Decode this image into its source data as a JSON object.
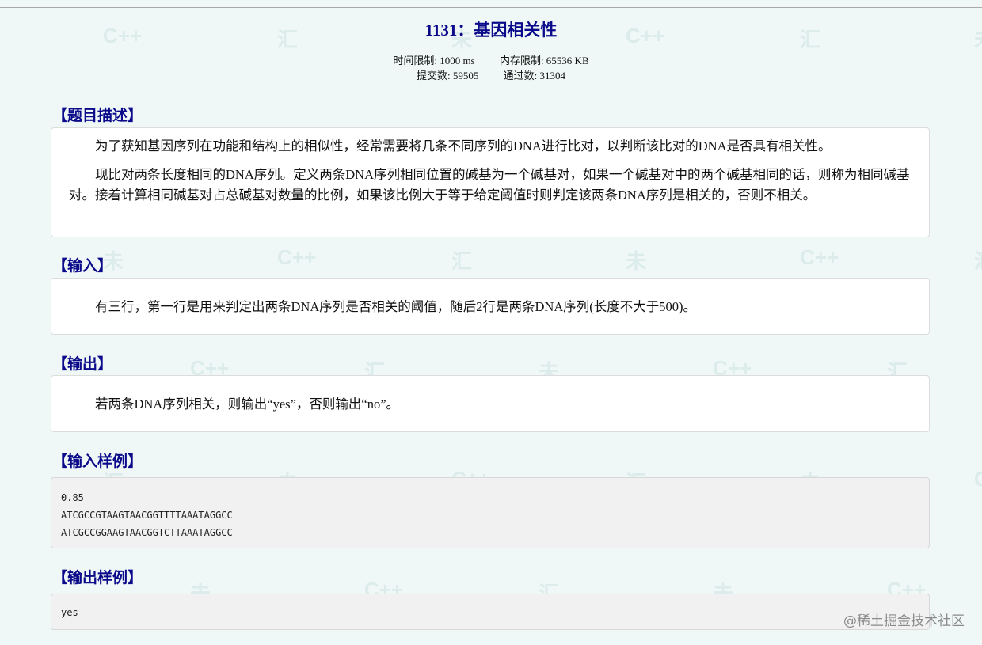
{
  "problem": {
    "title": "1131：基因相关性",
    "meta": {
      "time_limit": "时间限制: 1000 ms",
      "memory_limit": "内存限制: 65536 KB",
      "submissions": "提交数: 59505",
      "accepted": "通过数: 31304"
    }
  },
  "sections": {
    "description": {
      "heading": "【题目描述】",
      "paragraphs": [
        "为了获知基因序列在功能和结构上的相似性，经常需要将几条不同序列的DNA进行比对，以判断该比对的DNA是否具有相关性。",
        "现比对两条长度相同的DNA序列。定义两条DNA序列相同位置的碱基为一个碱基对，如果一个碱基对中的两个碱基相同的话，则称为相同碱基对。接着计算相同碱基对占总碱基对数量的比例，如果该比例大于等于给定阈值时则判定该两条DNA序列是相关的，否则不相关。"
      ]
    },
    "input": {
      "heading": "【输入】",
      "text": "有三行，第一行是用来判定出两条DNA序列是否相关的阈值，随后2行是两条DNA序列(长度不大于500)。"
    },
    "output": {
      "heading": "【输出】",
      "text": "若两条DNA序列相关，则输出“yes”，否则输出“no”。"
    },
    "sample_input": {
      "heading": "【输入样例】",
      "lines": [
        "0.85",
        "ATCGCCGTAAGTAACGGTTTTAAATAGGCC",
        "ATCGCCGGAAGTAACGGTCTTAAATAGGCC"
      ]
    },
    "sample_output": {
      "heading": "【输出样例】",
      "lines": [
        "yes"
      ]
    }
  },
  "watermark": {
    "text": "@稀土掘金技术社区",
    "tile_texts": [
      "C++",
      "汇",
      "未"
    ]
  },
  "colors": {
    "heading": "#0a0a8a",
    "background": "#f0f8f7"
  }
}
